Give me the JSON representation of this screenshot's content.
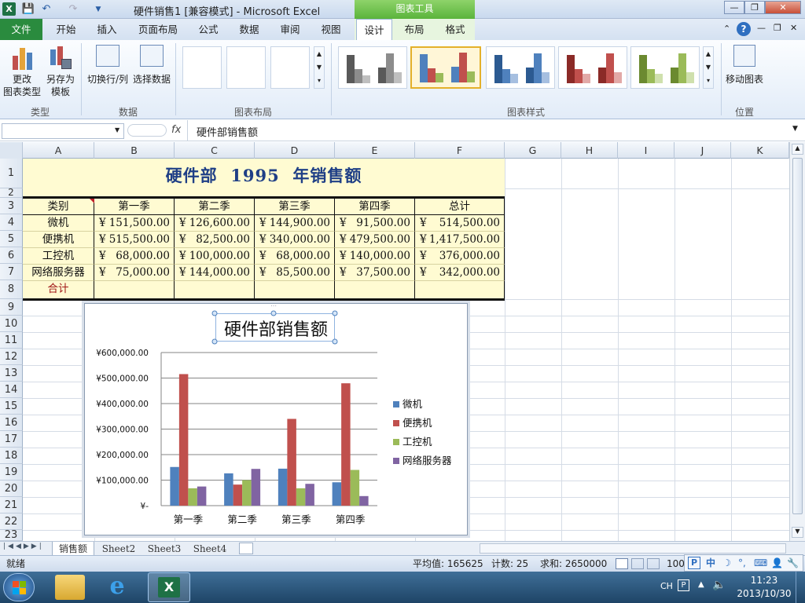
{
  "window": {
    "app_icon": "X",
    "title": "硬件销售1  [兼容模式] - Microsoft Excel",
    "context_tools": "图表工具",
    "min": "—",
    "max": "❐",
    "close": "✕"
  },
  "tabs": {
    "file": "文件",
    "home": "开始",
    "insert": "插入",
    "layout": "页面布局",
    "formula": "公式",
    "data": "数据",
    "review": "审阅",
    "view": "视图",
    "design": "设计",
    "chart_layout": "布局",
    "format": "格式"
  },
  "ribbon": {
    "change_type": "更改\n图表类型",
    "save_template": "另存为\n模板",
    "switch_rowcol": "切换行/列",
    "select_data": "选择数据",
    "move_chart": "移动图表",
    "group_type": "类型",
    "group_data": "数据",
    "group_layout": "图表布局",
    "group_style": "图表样式",
    "group_location": "位置"
  },
  "formula_bar": {
    "name_box": "",
    "fx": "fx",
    "content": "硬件部销售额"
  },
  "columns": [
    "A",
    "B",
    "C",
    "D",
    "E",
    "F",
    "G",
    "H",
    "I",
    "J",
    "K"
  ],
  "rows": [
    "1",
    "2",
    "3",
    "4",
    "5",
    "6",
    "7",
    "8",
    "9",
    "10",
    "11",
    "12",
    "13",
    "14",
    "15",
    "16",
    "17",
    "18",
    "19",
    "20",
    "21",
    "22",
    "23"
  ],
  "sheet": {
    "title": "硬件部  1995  年销售额",
    "headers": [
      "类别",
      "第一季",
      "第二季",
      "第三季",
      "第四季",
      "总计"
    ],
    "currency": "¥",
    "data_rows": [
      {
        "label": "微机",
        "values": [
          "151,500.00",
          "126,600.00",
          "144,900.00",
          "91,500.00",
          "514,500.00"
        ]
      },
      {
        "label": "便携机",
        "values": [
          "515,500.00",
          "82,500.00",
          "340,000.00",
          "479,500.00",
          "1,417,500.00"
        ]
      },
      {
        "label": "工控机",
        "values": [
          "68,000.00",
          "100,000.00",
          "68,000.00",
          "140,000.00",
          "376,000.00"
        ]
      },
      {
        "label": "网络服务器",
        "values": [
          "75,000.00",
          "144,000.00",
          "85,500.00",
          "37,500.00",
          "342,000.00"
        ]
      }
    ],
    "total_label": "合计"
  },
  "chart_data": {
    "type": "bar",
    "title": "硬件部销售额",
    "categories": [
      "第一季",
      "第二季",
      "第三季",
      "第四季"
    ],
    "series": [
      {
        "name": "微机",
        "color": "#4f81bd",
        "values": [
          151500,
          126600,
          144900,
          91500
        ]
      },
      {
        "name": "便携机",
        "color": "#c0504d",
        "values": [
          515500,
          82500,
          340000,
          479500
        ]
      },
      {
        "name": "工控机",
        "color": "#9bbb59",
        "values": [
          68000,
          100000,
          68000,
          140000
        ]
      },
      {
        "name": "网络服务器",
        "color": "#8064a2",
        "values": [
          75000,
          144000,
          85500,
          37500
        ]
      }
    ],
    "yticks": [
      "¥-",
      "¥100,000.00",
      "¥200,000.00",
      "¥300,000.00",
      "¥400,000.00",
      "¥500,000.00",
      "¥600,000.00"
    ],
    "ylim": [
      0,
      600000
    ],
    "legend": "right",
    "grid": true
  },
  "sheet_tabs": [
    "销售额",
    "Sheet2",
    "Sheet3",
    "Sheet4"
  ],
  "status": {
    "ready": "就绪",
    "average": "平均值: 165625",
    "count": "计数: 25",
    "sum": "求和: 2650000",
    "zoom": "100"
  },
  "ime": "中",
  "taskbar": {
    "lang": "CH",
    "time": "11:23",
    "date": "2013/10/30"
  }
}
